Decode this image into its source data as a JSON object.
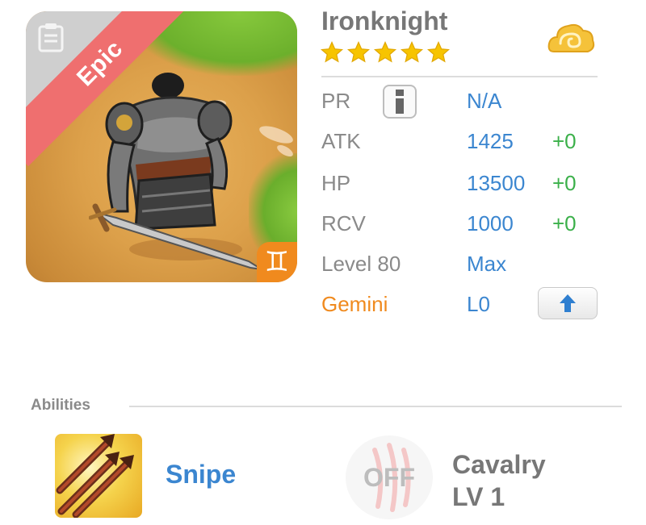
{
  "card": {
    "rarity": "Epic",
    "zodiac_symbol": "♊",
    "rarity_color": "#ef6f6f",
    "zodiac_color": "#f08a1e"
  },
  "hero": {
    "name": "Ironknight",
    "stars": 5,
    "element_icon": "cloud-element-icon"
  },
  "stats": {
    "pr": {
      "label": "PR",
      "value": "N/A"
    },
    "atk": {
      "label": "ATK",
      "value": "1425",
      "bonus": "+0"
    },
    "hp": {
      "label": "HP",
      "value": "13500",
      "bonus": "+0"
    },
    "rcv": {
      "label": "RCV",
      "value": "1000",
      "bonus": "+0"
    },
    "level": {
      "label": "Level 80",
      "value": "Max"
    },
    "zodiac": {
      "label": "Gemini",
      "value": "L0"
    }
  },
  "abilities": {
    "header": "Abilities",
    "items": [
      {
        "name": "Snipe",
        "icon": "arrows-icon"
      },
      {
        "name_line1": "Cavalry",
        "name_line2": "LV 1",
        "state": "OFF",
        "icon": "claw-icon"
      }
    ]
  },
  "colors": {
    "stat_value": "#3b86d0",
    "stat_bonus": "#3bb04a",
    "zodiac_label": "#f08a1e",
    "star": "#f7c400"
  }
}
